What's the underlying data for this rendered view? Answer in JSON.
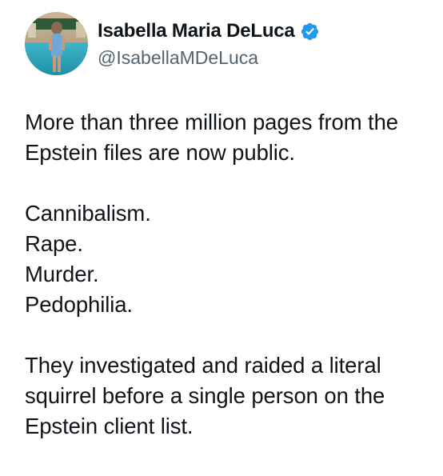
{
  "author": {
    "display_name": "Isabella Maria DeLuca",
    "handle": "@IsabellaMDeLuca",
    "verified": true,
    "avatar_icon": "profile-photo-pool",
    "verified_badge_color": "#1d9bf0"
  },
  "tweet": {
    "paragraph1": [
      "More than three million pages from the",
      "Epstein files are now public."
    ],
    "paragraph2": [
      "Cannibalism.",
      "Rape.",
      "Murder.",
      "Pedophilia."
    ],
    "paragraph3": [
      "They investigated and raided a literal",
      "squirrel before a single person on the",
      "Epstein client list."
    ]
  },
  "colors": {
    "text": "#0f1419",
    "secondary_text": "#536471",
    "background": "#ffffff"
  }
}
